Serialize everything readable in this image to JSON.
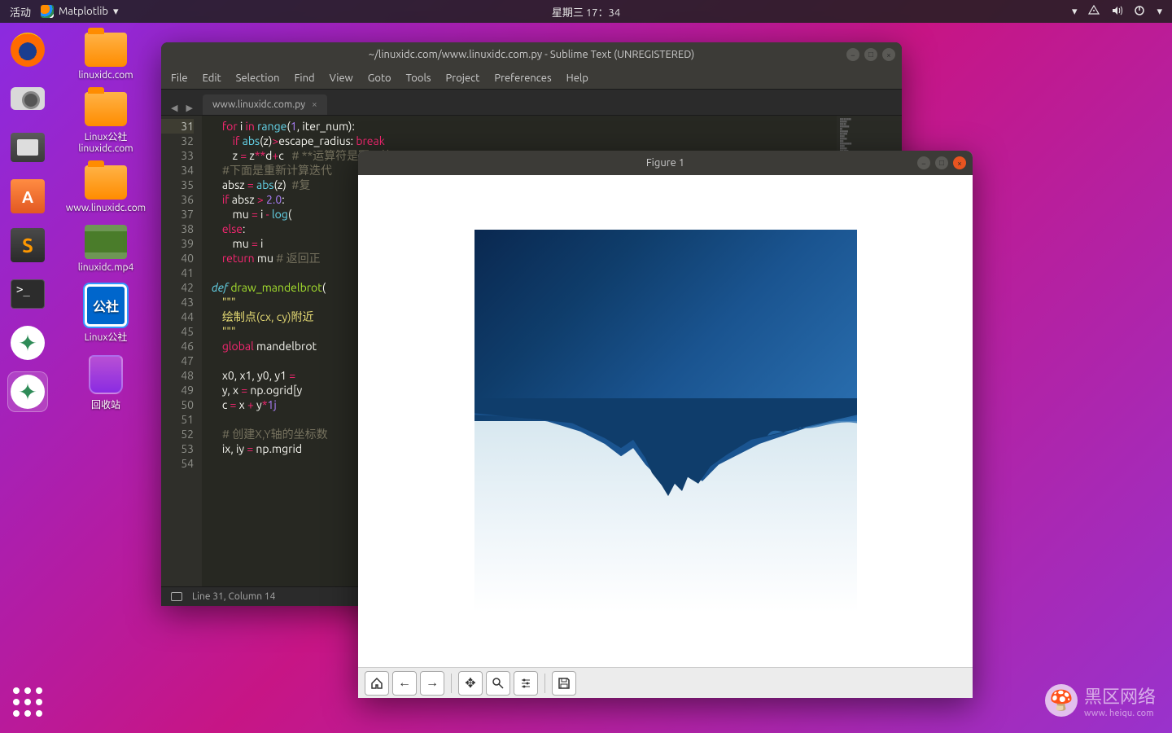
{
  "top_panel": {
    "activities": "活动",
    "app_name": "Matplotlib",
    "datetime": "星期三 17：34"
  },
  "desktop": {
    "icons": [
      "linuxidc.com",
      "Linux公社 linuxidc.com",
      "www.linuxidc.com",
      "linuxidc.mp4",
      "Linux公社",
      "回收站"
    ]
  },
  "sublime": {
    "title": "~/linuxidc.com/www.linuxidc.com.py - Sublime Text (UNREGISTERED)",
    "menu": [
      "File",
      "Edit",
      "Selection",
      "Find",
      "View",
      "Goto",
      "Tools",
      "Project",
      "Preferences",
      "Help"
    ],
    "tab": "www.linuxidc.com.py",
    "status": "Line 31, Column 14",
    "line_start": 31,
    "line_end": 54,
    "code_lines": [
      {
        "n": 31,
        "html": "    <span class='kw'>for</span> <span class='var'>i</span> <span class='kw'>in</span> <span class='fn'>range</span>(<span class='num'>1</span>, iter_num):"
      },
      {
        "n": 32,
        "html": "        <span class='kw'>if</span> <span class='fn'>abs</span>(z)<span class='op'>&gt;</span>escape_radius: <span class='kw'>break</span>"
      },
      {
        "n": 33,
        "html": "        z <span class='op'>=</span> z<span class='op'>**</span>d<span class='op'>+</span>c   <span class='cm'># **运算符是幂运算</span>"
      },
      {
        "n": 34,
        "html": "    <span class='cm'>#下面是重新计算迭代</span>"
      },
      {
        "n": 35,
        "html": "    absz <span class='op'>=</span> <span class='fn'>abs</span>(z)  <span class='cm'>#复</span>"
      },
      {
        "n": 36,
        "html": "    <span class='kw'>if</span> absz <span class='op'>&gt;</span> <span class='num'>2.0</span>:"
      },
      {
        "n": 37,
        "html": "        mu <span class='op'>=</span> i <span class='op'>-</span> <span class='fn'>log</span>("
      },
      {
        "n": 38,
        "html": "    <span class='kw'>else</span>:"
      },
      {
        "n": 39,
        "html": "        mu <span class='op'>=</span> i"
      },
      {
        "n": 40,
        "html": "    <span class='kw'>return</span> mu <span class='cm'># 返回正</span>"
      },
      {
        "n": 41,
        "html": ""
      },
      {
        "n": 42,
        "html": "<span class='def'>def</span> <span class='name'>draw_mandelbrot</span>("
      },
      {
        "n": 43,
        "html": "    <span class='str'>\"\"\"</span>"
      },
      {
        "n": 44,
        "html": "    <span class='str'>绘制点(cx, cy)附近</span>"
      },
      {
        "n": 45,
        "html": "    <span class='str'>\"\"\"</span>"
      },
      {
        "n": 46,
        "html": "    <span class='kw'>global</span> mandelbrot"
      },
      {
        "n": 47,
        "html": ""
      },
      {
        "n": 48,
        "html": "    x0, x1, y0, y1 <span class='op'>=</span>"
      },
      {
        "n": 49,
        "html": "    y, x <span class='op'>=</span> np.ogrid[y"
      },
      {
        "n": 50,
        "html": "    c <span class='op'>=</span> x <span class='op'>+</span> y<span class='op'>*</span><span class='num'>1j</span>"
      },
      {
        "n": 51,
        "html": ""
      },
      {
        "n": 52,
        "html": "    <span class='cm'># 创建X,Y轴的坐标数</span>"
      },
      {
        "n": 53,
        "html": "    ix, iy <span class='op'>=</span> np.mgrid"
      },
      {
        "n": 54,
        "html": ""
      }
    ]
  },
  "figure": {
    "title": "Figure 1"
  },
  "watermark": {
    "main": "黑区网络",
    "sub": "www. heiqu. com"
  }
}
